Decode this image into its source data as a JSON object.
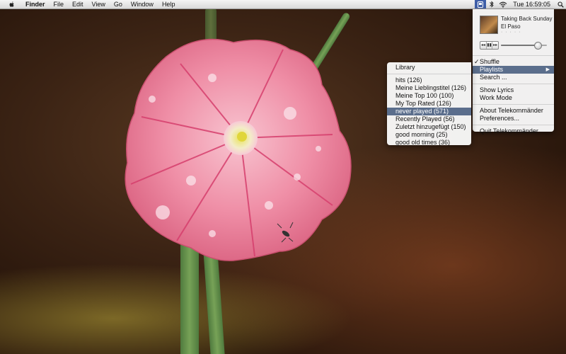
{
  "menubar": {
    "items": [
      "Finder",
      "File",
      "Edit",
      "View",
      "Go",
      "Window",
      "Help"
    ],
    "clock": "Tue 16:59:05"
  },
  "status_menu": {
    "now_playing": {
      "track": "Taking Back Sunday",
      "artist": "El Paso",
      "rating": "· · · · ·",
      "volume": 0.8
    },
    "shuffle_label": "Shuffle",
    "playlists_label": "Playlists",
    "search_label": "Search ...",
    "show_lyrics_label": "Show Lyrics",
    "work_mode_label": "Work Mode",
    "about_label": "About Telekommänder",
    "preferences_label": "Preferences...",
    "quit_label": "Quit Telekommänder"
  },
  "playlists_menu": {
    "library_label": "Library",
    "items": [
      "hits (126)",
      "Meine Lieblingstitel (126)",
      "Meine Top 100 (100)",
      "My Top Rated (126)",
      "never played (571)",
      "Recently Played (56)",
      "Zuletzt hinzugefügt (150)",
      "good morning (25)",
      "good old times (36)"
    ],
    "highlighted_index": 4
  },
  "colors": {
    "highlight": "#5b6e8c",
    "menubar_active": "#3f5fa8"
  }
}
